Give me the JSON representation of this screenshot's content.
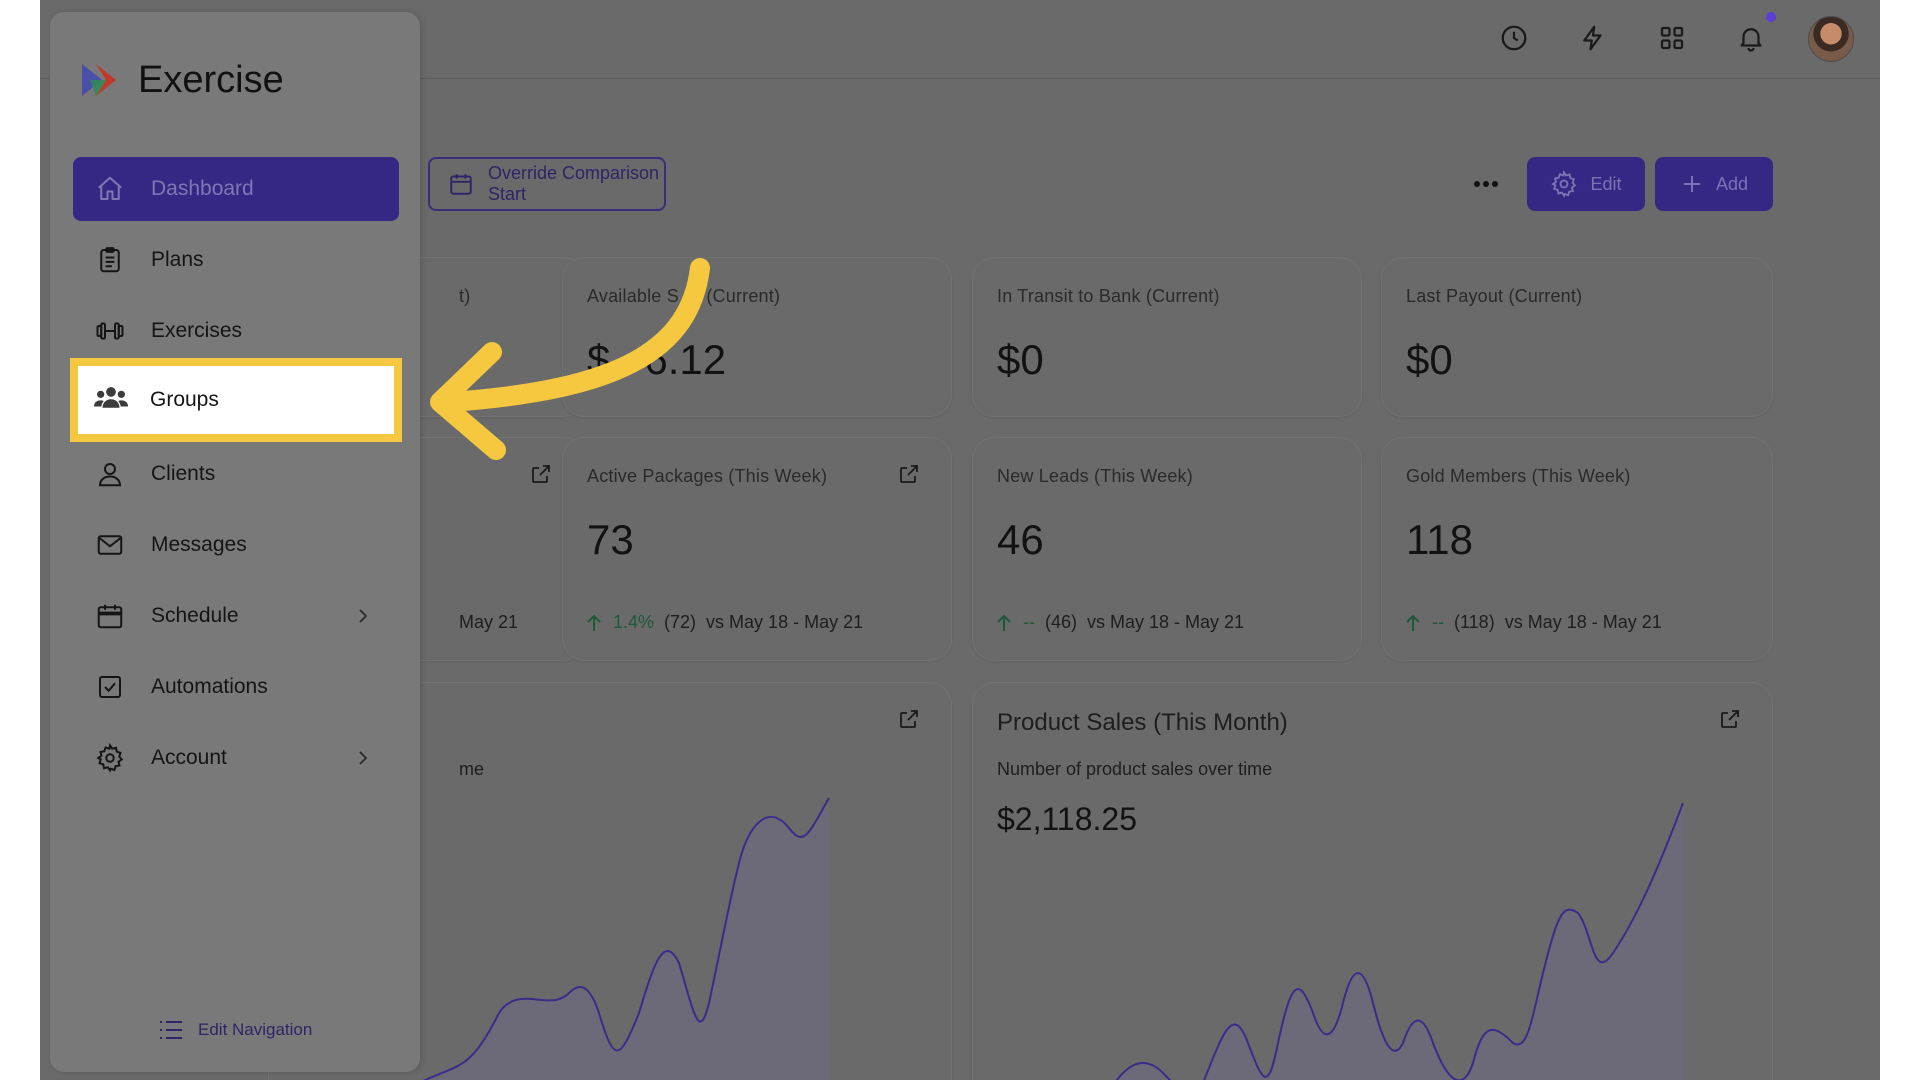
{
  "brand": {
    "name": "Exercise"
  },
  "topbar": {
    "icons": [
      "clock-icon",
      "bolt-icon",
      "grid-icon",
      "bell-icon"
    ],
    "notification_dot": true
  },
  "toolbar": {
    "override_label": "Override Comparison Start",
    "edit_label": "Edit",
    "add_label": "Add"
  },
  "sidebar": {
    "items": [
      {
        "label": "Dashboard",
        "icon": "home-icon",
        "active": true
      },
      {
        "label": "Plans",
        "icon": "clipboard-icon"
      },
      {
        "label": "Exercises",
        "icon": "dumbbell-icon"
      },
      {
        "label": "Groups",
        "icon": "users-icon",
        "highlighted": true
      },
      {
        "label": "Clients",
        "icon": "user-icon"
      },
      {
        "label": "Messages",
        "icon": "mail-icon"
      },
      {
        "label": "Schedule",
        "icon": "calendar-icon",
        "has_submenu": true
      },
      {
        "label": "Automations",
        "icon": "checkbox-icon"
      },
      {
        "label": "Account",
        "icon": "gear-icon",
        "has_submenu": true
      }
    ],
    "edit_nav_label": "Edit Navigation"
  },
  "cards": {
    "row1": [
      {
        "label": "t)",
        "value": ""
      },
      {
        "label": "Available S",
        "label_tail": "n (Current)",
        "value": "$",
        "value_tail": "6.12"
      },
      {
        "label": "In Transit to Bank (Current)",
        "value": "$0"
      },
      {
        "label": "Last Payout (Current)",
        "value": "$0"
      }
    ],
    "row2": [
      {
        "label": "",
        "value": "",
        "compare": "May 21"
      },
      {
        "label": "Active Packages (This Week)",
        "value": "73",
        "pct": "1.4%",
        "prev": "(72)",
        "range": "vs May 18 - May 21"
      },
      {
        "label": "New Leads (This Week)",
        "value": "46",
        "pct": "--",
        "prev": "(46)",
        "range": "vs May 18 - May 21"
      },
      {
        "label": "Gold Members (This Week)",
        "value": "118",
        "pct": "--",
        "prev": "(118)",
        "range": "vs May 18 - May 21"
      }
    ]
  },
  "charts": {
    "left": {
      "subtitle_tail": "me"
    },
    "right": {
      "title": "Product Sales (This Month)",
      "subtitle": "Number of product sales over time",
      "total": "$2,118.25"
    }
  },
  "colors": {
    "accent": "#342884",
    "highlight": "#f6c83f",
    "overlay_bg": "#6a6a6a"
  }
}
